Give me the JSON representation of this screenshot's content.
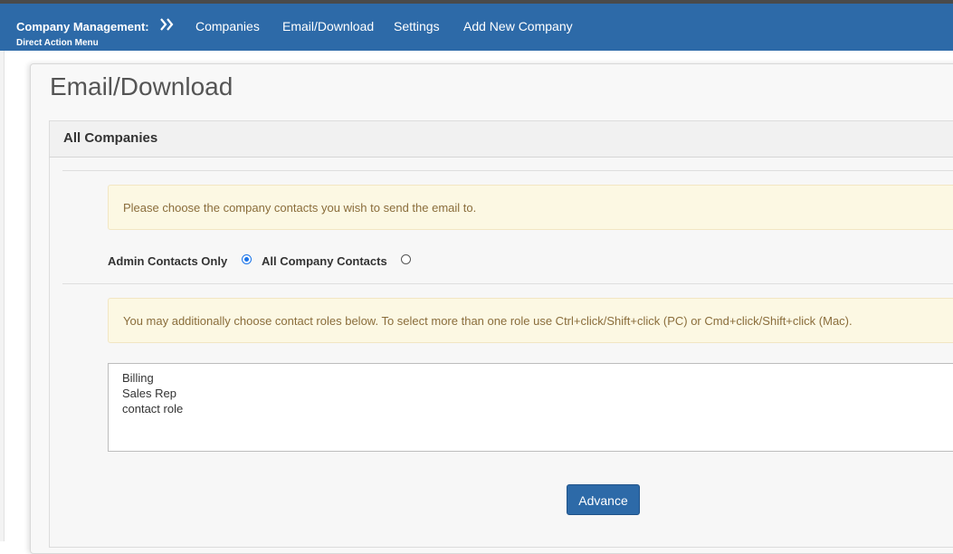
{
  "navbar": {
    "brand": "Company Management:",
    "brand_sub": "Direct Action Menu",
    "items": [
      {
        "label": "Companies"
      },
      {
        "label": "Email/Download"
      },
      {
        "label": "Settings"
      },
      {
        "label": "Add New Company"
      }
    ]
  },
  "page": {
    "title": "Email/Download"
  },
  "card": {
    "title": "All Companies",
    "alert_contacts": "Please choose the company contacts you wish to send the email to.",
    "radio_options": [
      {
        "label": "Admin Contacts Only",
        "selected": true
      },
      {
        "label": "All Company Contacts",
        "selected": false
      }
    ],
    "alert_roles": "You may additionally choose contact roles below. To select more than one role use Ctrl+click/Shift+click (PC) or Cmd+click/Shift+click (Mac).",
    "roles": [
      "Billing",
      "Sales Rep",
      "contact role"
    ],
    "advance_label": "Advance"
  },
  "colors": {
    "navbar_bg": "#2d6aa8",
    "alert_bg": "#fcf8e3",
    "alert_text": "#8a6d3b",
    "button_bg": "#2d6aa8"
  }
}
